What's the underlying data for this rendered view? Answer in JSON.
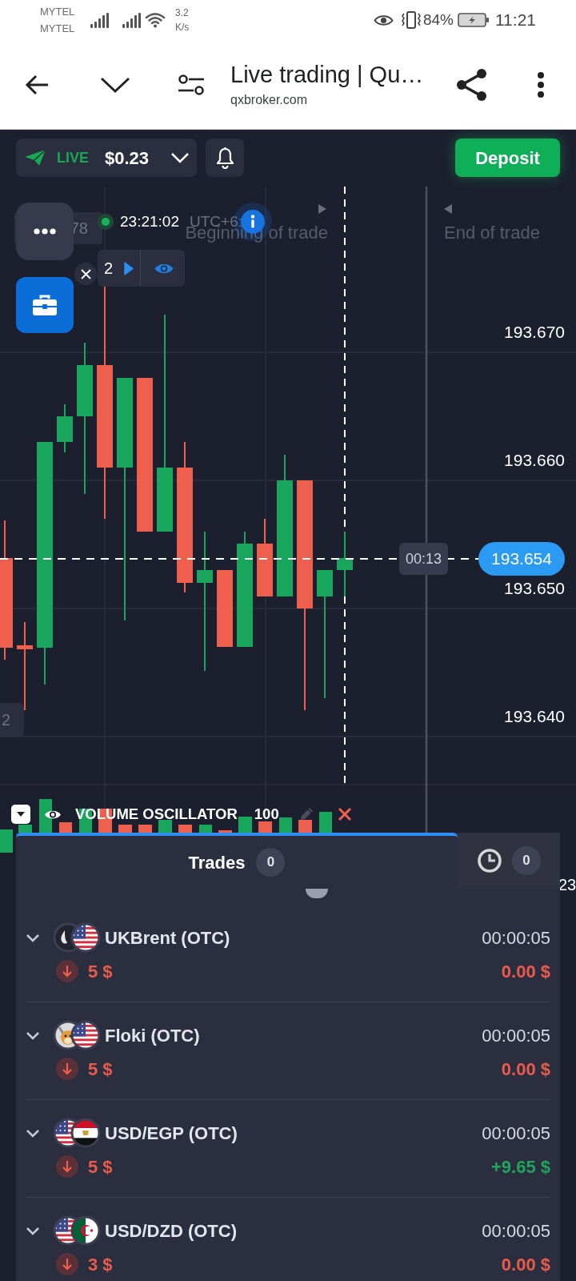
{
  "status_bar": {
    "carriers": [
      "MYTEL",
      "MYTEL"
    ],
    "speed": {
      "value": "3.2",
      "unit": "K/s"
    },
    "battery": "84%",
    "time": "11:21"
  },
  "browser": {
    "title": "Live trading | Qu…",
    "url": "qxbroker.com"
  },
  "toolbar": {
    "account_mode": "LIVE",
    "balance": "$0.23",
    "deposit": "Deposit"
  },
  "chart": {
    "tag_label": "78",
    "time": "23:21:02",
    "timezone": "UTC+6:",
    "markers": [
      "Beginning of trade",
      "End of trade"
    ],
    "trade_counter": "2",
    "price_labels": [
      "193.670",
      "193.660",
      "193.650",
      "193.640"
    ],
    "countdown": "00:13",
    "current_price": "193.654",
    "edge_label": "2",
    "axis_edge_label": "23"
  },
  "indicator": {
    "name": "VOLUME OSCILLATOR",
    "period": "100"
  },
  "trade_tabs": [
    {
      "label": "Trades",
      "count": "0",
      "selected": true
    },
    {
      "count": "0",
      "selected": false
    }
  ],
  "trades": [
    {
      "asset": "UKBrent (OTC)",
      "time": "00:00:05",
      "down": true,
      "amount": "5 $",
      "profit": "0.00 $",
      "won": false
    },
    {
      "asset": "Floki (OTC)",
      "time": "00:00:05",
      "down": true,
      "amount": "5 $",
      "profit": "0.00 $",
      "won": false
    },
    {
      "asset": "USD/EGP (OTC)",
      "time": "00:00:05",
      "down": true,
      "amount": "5 $",
      "profit": "+9.65 $",
      "won": true
    },
    {
      "asset": "USD/DZD (OTC)",
      "time": "00:00:05",
      "down": true,
      "amount": "3 $",
      "profit": "0.00 $",
      "won": false
    }
  ]
}
